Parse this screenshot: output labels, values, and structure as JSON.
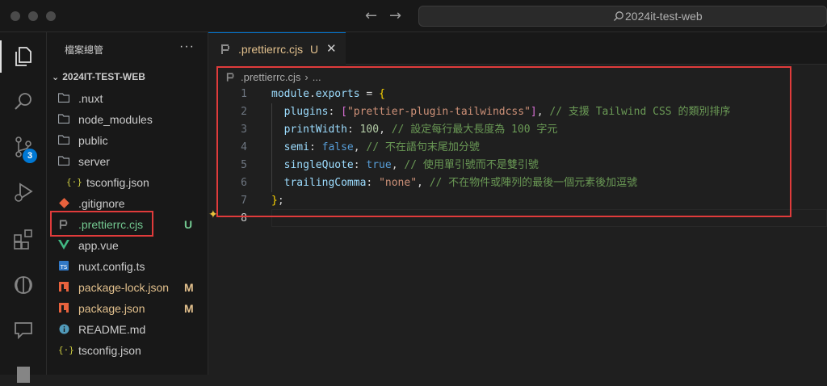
{
  "window": {
    "title": "2024it-test-web"
  },
  "explorer": {
    "title": "檔案總管",
    "more": "···",
    "project": "2024IT-TEST-WEB",
    "items": [
      {
        "label": ".nuxt",
        "icon": "folder-icon",
        "indent": 0,
        "status": ""
      },
      {
        "label": "node_modules",
        "icon": "folder-icon",
        "indent": 0,
        "status": ""
      },
      {
        "label": "public",
        "icon": "folder-icon",
        "indent": 0,
        "status": ""
      },
      {
        "label": "server",
        "icon": "folder-open-icon",
        "indent": 0,
        "status": ""
      },
      {
        "label": "tsconfig.json",
        "icon": "json-icon",
        "indent": 1,
        "status": ""
      },
      {
        "label": ".gitignore",
        "icon": "git-icon",
        "indent": 0,
        "status": ""
      },
      {
        "label": ".prettierrc.cjs",
        "icon": "prettier-icon",
        "indent": 0,
        "status": "U"
      },
      {
        "label": "app.vue",
        "icon": "vue-icon",
        "indent": 0,
        "status": ""
      },
      {
        "label": "nuxt.config.ts",
        "icon": "ts-icon",
        "indent": 0,
        "status": ""
      },
      {
        "label": "package-lock.json",
        "icon": "npm-icon",
        "indent": 0,
        "status": "M"
      },
      {
        "label": "package.json",
        "icon": "npm-icon",
        "indent": 0,
        "status": "M"
      },
      {
        "label": "README.md",
        "icon": "info-icon",
        "indent": 0,
        "status": ""
      },
      {
        "label": "tsconfig.json",
        "icon": "json-icon",
        "indent": 0,
        "status": ""
      }
    ]
  },
  "activity": {
    "scm_badge": "3"
  },
  "editor": {
    "tab": {
      "name": ".prettierrc.cjs",
      "status": "U",
      "close": "✕"
    },
    "breadcrumb": {
      "file": ".prettierrc.cjs",
      "sep": "›",
      "rest": "..."
    },
    "lines": [
      {
        "num": "1",
        "tokens": [
          [
            "k",
            "module"
          ],
          [
            "o",
            "."
          ],
          [
            "k",
            "exports"
          ],
          [
            "o",
            " = "
          ],
          [
            "b",
            "{"
          ]
        ]
      },
      {
        "num": "2",
        "tokens": [
          [
            "o",
            "  "
          ],
          [
            "k",
            "plugins"
          ],
          [
            "o",
            ": "
          ],
          [
            "b2",
            "["
          ],
          [
            "s",
            "\"prettier-plugin-tailwindcss\""
          ],
          [
            "b2",
            "]"
          ],
          [
            "o",
            ", "
          ],
          [
            "c",
            "// 支援 Tailwind CSS 的類別排序"
          ]
        ]
      },
      {
        "num": "3",
        "tokens": [
          [
            "o",
            "  "
          ],
          [
            "k",
            "printWidth"
          ],
          [
            "o",
            ": "
          ],
          [
            "n",
            "100"
          ],
          [
            "o",
            ", "
          ],
          [
            "c",
            "// 設定每行最大長度為 100 字元"
          ]
        ]
      },
      {
        "num": "4",
        "tokens": [
          [
            "o",
            "  "
          ],
          [
            "k",
            "semi"
          ],
          [
            "o",
            ": "
          ],
          [
            "kw",
            "false"
          ],
          [
            "o",
            ", "
          ],
          [
            "c",
            "// 不在語句末尾加分號"
          ]
        ]
      },
      {
        "num": "5",
        "tokens": [
          [
            "o",
            "  "
          ],
          [
            "k",
            "singleQuote"
          ],
          [
            "o",
            ": "
          ],
          [
            "kw",
            "true"
          ],
          [
            "o",
            ", "
          ],
          [
            "c",
            "// 使用單引號而不是雙引號"
          ]
        ]
      },
      {
        "num": "6",
        "tokens": [
          [
            "o",
            "  "
          ],
          [
            "k",
            "trailingComma"
          ],
          [
            "o",
            ": "
          ],
          [
            "s",
            "\"none\""
          ],
          [
            "o",
            ", "
          ],
          [
            "c",
            "// 不在物件或陣列的最後一個元素後加逗號"
          ]
        ]
      },
      {
        "num": "7",
        "tokens": [
          [
            "b",
            "}"
          ],
          [
            "o",
            ";"
          ]
        ]
      },
      {
        "num": "8",
        "tokens": []
      }
    ]
  },
  "colors": {
    "accent": "#0078d4",
    "highlight": "#e03b3b",
    "modified": "#e2c08d",
    "untracked": "#73c991"
  }
}
